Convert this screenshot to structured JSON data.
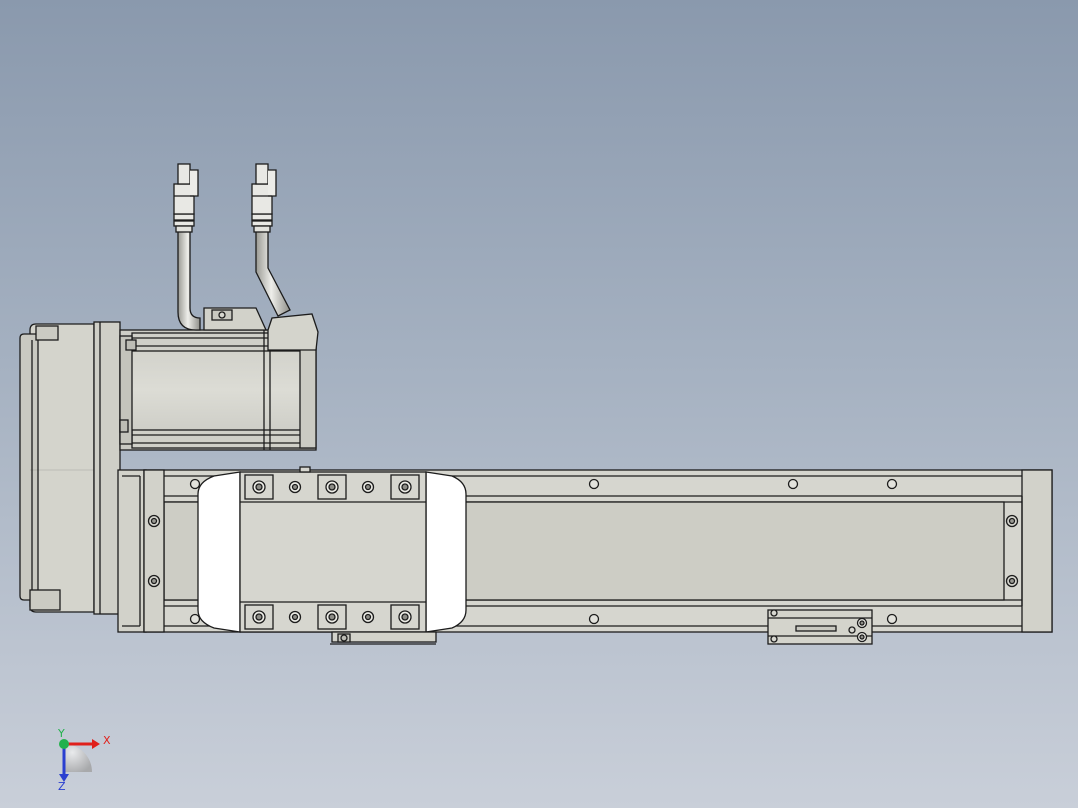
{
  "viewport": {
    "background_top": "#8a99ad",
    "background_bottom": "#c9cfd9"
  },
  "colors": {
    "body": "#d6d6cf",
    "body_dark": "#c6c6be",
    "line": "#1c1c1c",
    "carriage": "#ffffff",
    "cable": "#cfcfc9",
    "axis_x": "#e0201b",
    "axis_y": "#22b14c",
    "axis_z": "#2a3fd0"
  },
  "triad": {
    "x_label": "X",
    "y_label": "Y",
    "z_label": "Z"
  }
}
